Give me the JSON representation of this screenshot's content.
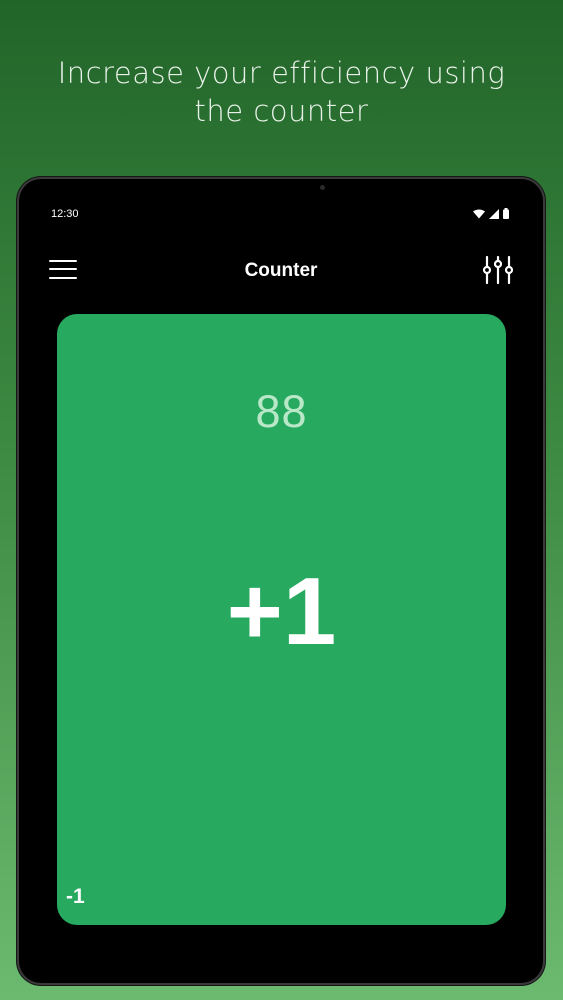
{
  "promo": {
    "headline_line1": "Increase your efficiency using",
    "headline_line2": "the counter"
  },
  "status_bar": {
    "time": "12:30",
    "icons": [
      "wifi-icon",
      "signal-icon",
      "battery-icon"
    ]
  },
  "app_bar": {
    "title": "Counter",
    "menu_icon": "hamburger-menu-icon",
    "settings_icon": "sliders-settings-icon"
  },
  "counter": {
    "value": "88",
    "increment_label": "+1",
    "decrement_label": "-1"
  },
  "colors": {
    "background_top": "#226529",
    "background_bottom": "#6cba70",
    "card": "#27a95f",
    "count_text": "#b9e8c9",
    "device": "#000000"
  }
}
